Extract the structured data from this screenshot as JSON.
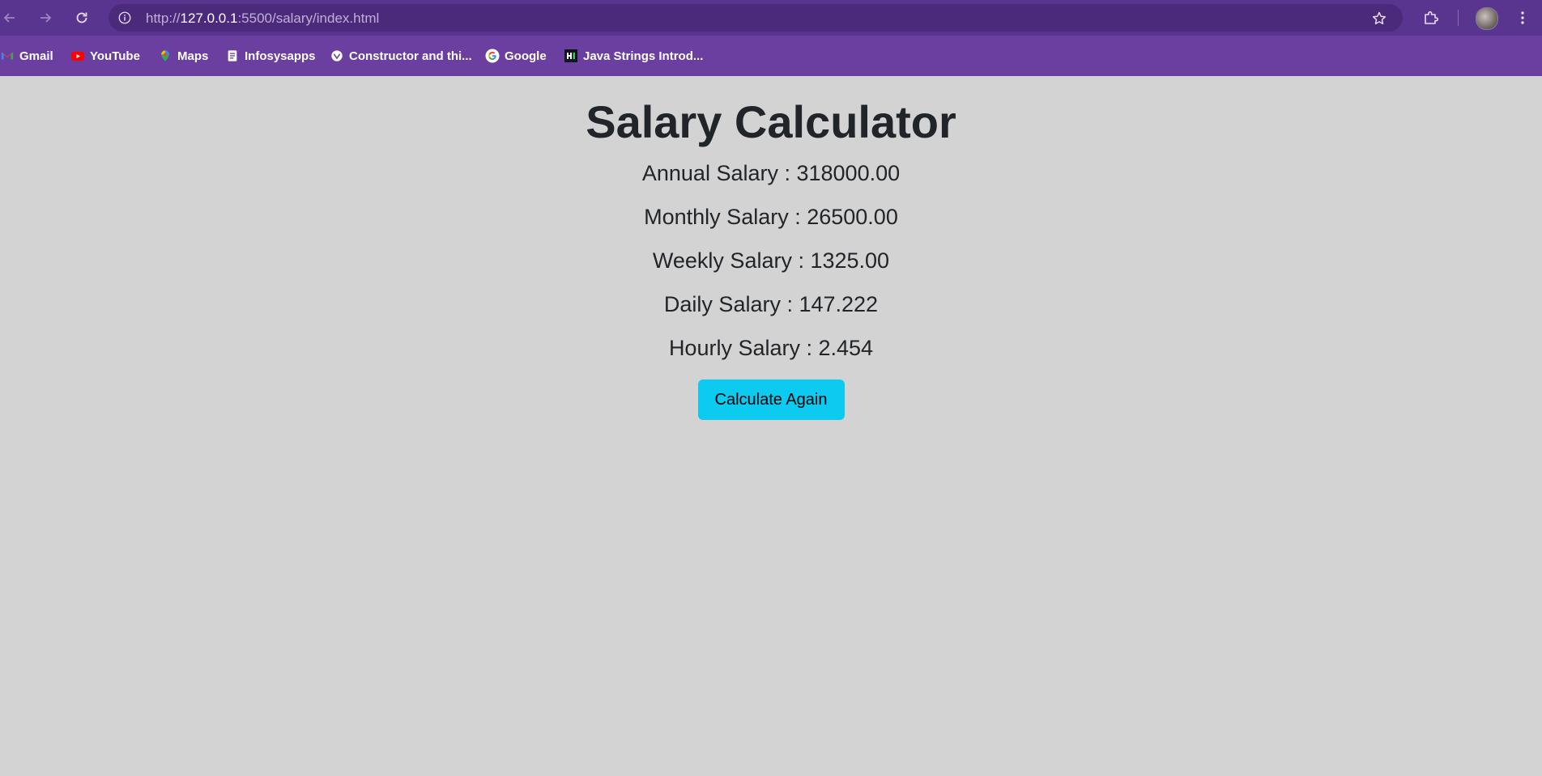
{
  "browser": {
    "url_prefix": "http://",
    "url_host": "127.0.0.1",
    "url_rest": ":5500/salary/index.html",
    "bookmarks": [
      {
        "label": "Gmail",
        "icon": "gmail-icon"
      },
      {
        "label": "YouTube",
        "icon": "youtube-icon"
      },
      {
        "label": "Maps",
        "icon": "maps-icon"
      },
      {
        "label": "Infosysapps",
        "icon": "document-icon"
      },
      {
        "label": "Constructor and thi...",
        "icon": "shield-icon"
      },
      {
        "label": "Google",
        "icon": "google-icon"
      },
      {
        "label": "Java Strings Introd...",
        "icon": "hackerrank-icon"
      }
    ]
  },
  "page": {
    "title": "Salary Calculator",
    "lines": [
      "Annual Salary : 318000.00",
      "Monthly Salary : 26500.00",
      "Weekly Salary : 1325.00",
      "Daily Salary : 147.222",
      "Hourly Salary : 2.454"
    ],
    "button_label": "Calculate Again"
  },
  "colors": {
    "chrome": "#6b3fa0",
    "toolbar": "#5a3590",
    "page_bg": "#d3d3d3",
    "button_bg": "#0dcaf0",
    "text": "#212529"
  }
}
